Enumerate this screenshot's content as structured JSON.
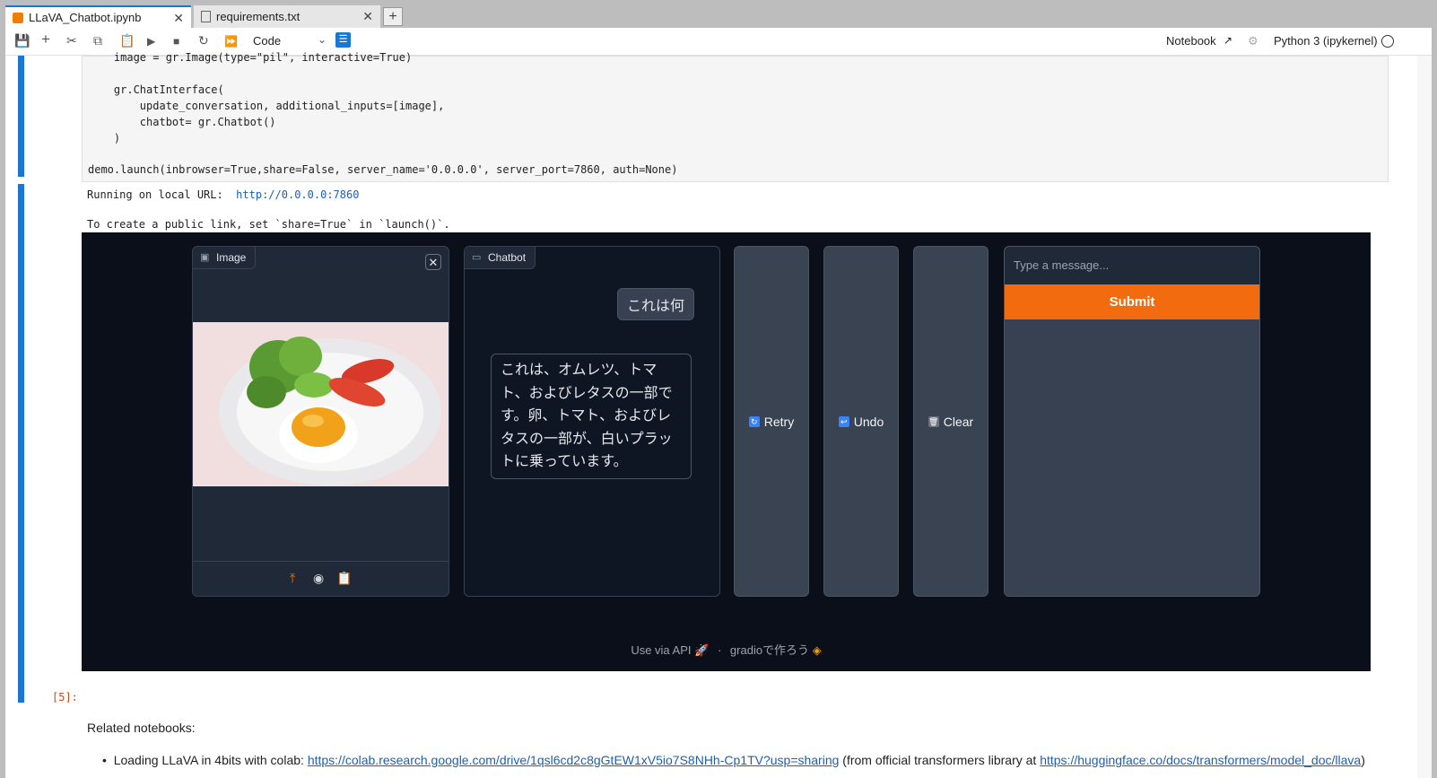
{
  "tabs": [
    {
      "label": "LLaVA_Chatbot.ipynb",
      "active": true
    },
    {
      "label": "requirements.txt",
      "active": false
    }
  ],
  "toolbar": {
    "cell_type": "Code",
    "notebook_label": "Notebook",
    "kernel_label": "Python 3 (ipykernel)"
  },
  "code_lines": [
    "    image = gr.Image(type=\"pil\", interactive=True)",
    "",
    "    gr.ChatInterface(",
    "        update_conversation, additional_inputs=[image],",
    "        chatbot= gr.Chatbot()",
    "    )",
    "",
    "demo.launch(inbrowser=True,share=False, server_name='0.0.0.0', server_port=7860, auth=None)"
  ],
  "output": {
    "running_text": "Running on local URL:  ",
    "url": "http://0.0.0.0:7860",
    "public_link_text": "To create a public link, set `share=True` in `launch()`."
  },
  "gradio": {
    "image_label": "Image",
    "chatbot_label": "Chatbot",
    "user_message": "これは何",
    "bot_message": "これは、オムレツ、トマト、およびレタスの一部です。卵、トマト、およびレタスの一部が、白いプラットに乗っています。",
    "retry_label": "Retry",
    "undo_label": "Undo",
    "clear_label": "Clear",
    "message_placeholder": "Type a message...",
    "submit_label": "Submit",
    "footer_api": "Use via API",
    "footer_separator": "·",
    "footer_gradio": "gradioで作ろう"
  },
  "cell_prompt": "[5]:",
  "markdown": {
    "heading": "Related notebooks:",
    "bullet_prefix": "Loading LLaVA in 4bits with colab: ",
    "colab_link": "https://colab.research.google.com/drive/1qsl6cd2c8gGtEW1xV5io7S8NHh-Cp1TV?usp=sharing",
    "bullet_mid": " (from official transformers library at ",
    "hf_link": "https://huggingface.co/docs/transformers/model_doc/llava",
    "bullet_suffix": ")"
  }
}
